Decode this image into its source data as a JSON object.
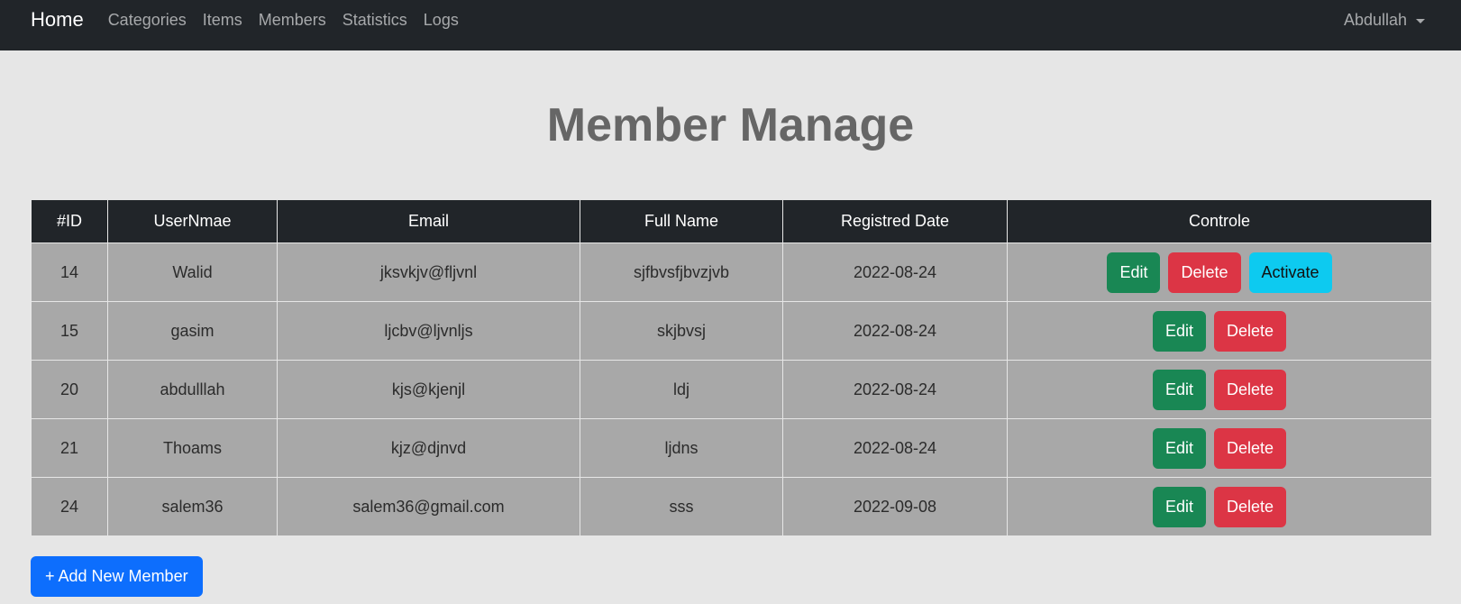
{
  "navbar": {
    "brand": "Home",
    "links": [
      "Categories",
      "Items",
      "Members",
      "Statistics",
      "Logs"
    ],
    "user": "Abdullah"
  },
  "page": {
    "title": "Member Manage"
  },
  "table": {
    "headers": [
      "#ID",
      "UserNmae",
      "Email",
      "Full Name",
      "Registred Date",
      "Controle"
    ],
    "rows": [
      {
        "id": "14",
        "username": "Walid",
        "email": "jksvkjv@fljvnl",
        "fullname": "sjfbvsfjbvzjvb",
        "date": "2022-08-24",
        "activate": "Activate"
      },
      {
        "id": "15",
        "username": "gasim",
        "email": "ljcbv@ljvnljs",
        "fullname": "skjbvsj",
        "date": "2022-08-24"
      },
      {
        "id": "20",
        "username": "abdulllah",
        "email": "kjs@kjenjl",
        "fullname": "ldj",
        "date": "2022-08-24"
      },
      {
        "id": "21",
        "username": "Thoams",
        "email": "kjz@djnvd",
        "fullname": "ljdns",
        "date": "2022-08-24"
      },
      {
        "id": "24",
        "username": "salem36",
        "email": "salem36@gmail.com",
        "fullname": "sss",
        "date": "2022-09-08"
      }
    ],
    "edit_label": "Edit",
    "delete_label": "Delete"
  },
  "add_button": "+ Add New Member",
  "colors": {
    "navbar": "#212529",
    "background": "#e6e6e6",
    "row": "#a8a8a8",
    "edit": "#198754",
    "delete": "#dc3545",
    "activate": "#0dcaf0",
    "primary": "#0d6efd"
  }
}
